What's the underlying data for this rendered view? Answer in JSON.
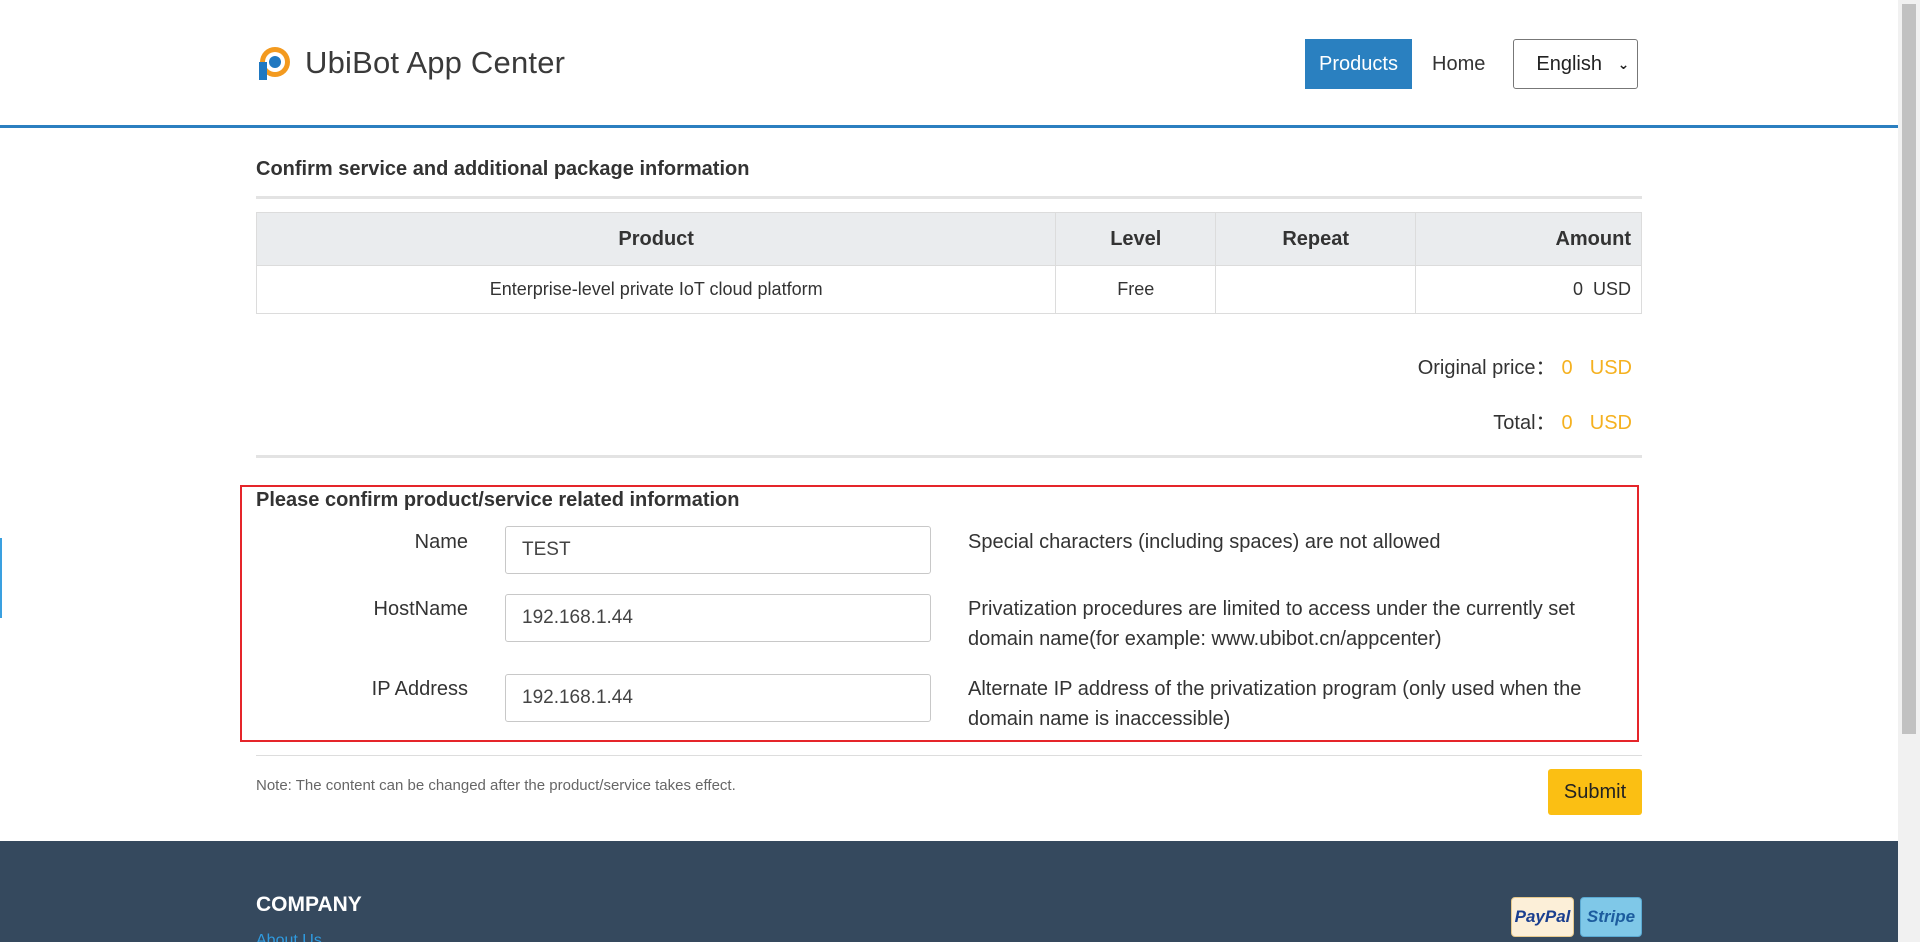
{
  "header": {
    "brand": "UbiBot App Center",
    "nav": {
      "products": "Products",
      "home": "Home"
    },
    "language": "English"
  },
  "summary": {
    "title": "Confirm service and additional package information",
    "table": {
      "headers": [
        "Product",
        "Level",
        "Repeat",
        "Amount"
      ],
      "row": {
        "product": "Enterprise-level private IoT cloud platform",
        "level": "Free",
        "repeat": "",
        "amount_value": "0",
        "amount_unit": "USD"
      }
    },
    "original_price": {
      "label": "Original price：",
      "value": "0",
      "unit": "USD"
    },
    "total": {
      "label": "Total：",
      "value": "0",
      "unit": "USD"
    }
  },
  "confirm": {
    "title": "Please confirm product/service related information",
    "fields": [
      {
        "label": "Name",
        "value": "TEST",
        "help": "Special characters (including spaces) are not allowed"
      },
      {
        "label": "HostName",
        "value": "192.168.1.44",
        "help": "Privatization procedures are limited to access under the currently set domain name(for example: www.ubibot.cn/appcenter)"
      },
      {
        "label": "IP Address",
        "value": "192.168.1.44",
        "help": "Alternate IP address of the privatization program (only used when the domain name is inaccessible)"
      }
    ]
  },
  "note": "Note: The content can be changed after the product/service takes effect.",
  "submit": "Submit",
  "footer": {
    "company": "COMPANY",
    "link": "About Us",
    "payments": [
      "PayPal",
      "Stripe"
    ]
  },
  "colors": {
    "accent_blue": "#2a80c0",
    "price_orange": "#f5b120",
    "submit_yellow": "#fbbf13",
    "highlight_red": "#e5252a",
    "footer_bg": "#35495e"
  }
}
